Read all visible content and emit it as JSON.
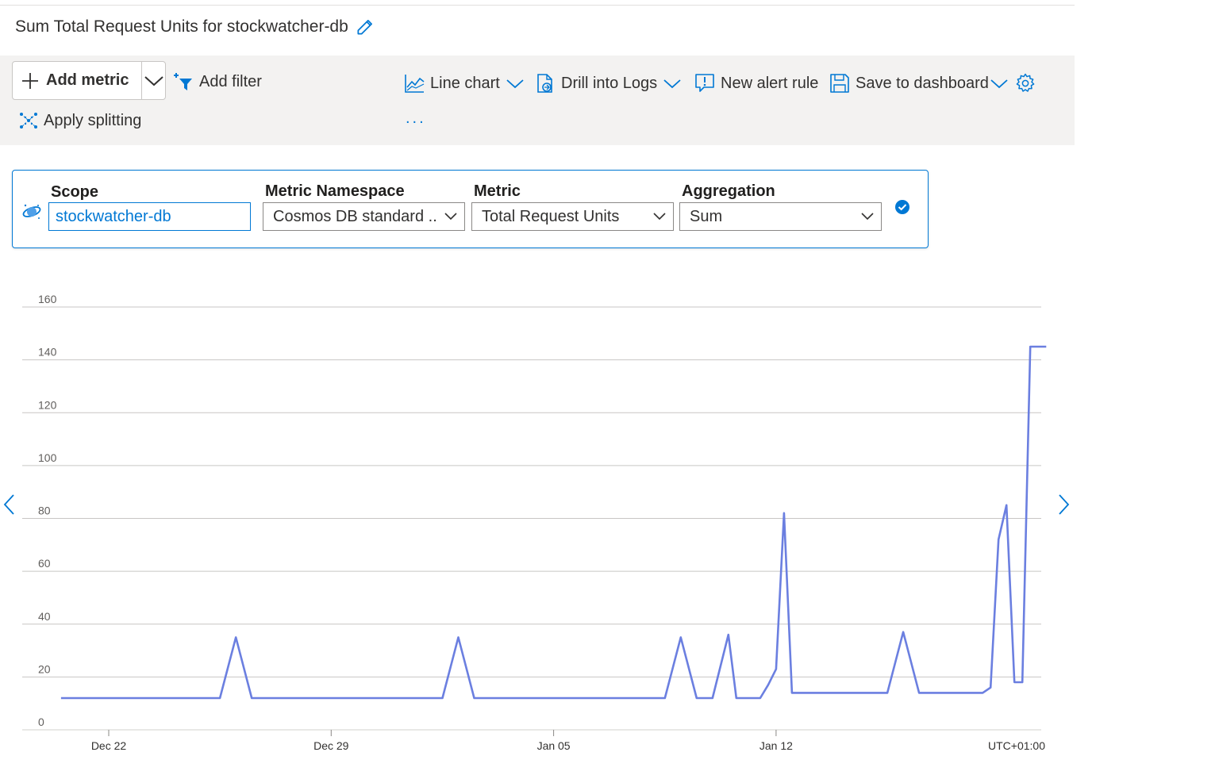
{
  "header": {
    "title": "Sum Total Request Units for stockwatcher-db"
  },
  "toolbar": {
    "add_metric": "Add metric",
    "add_filter": "Add filter",
    "apply_splitting": "Apply splitting",
    "line_chart": "Line chart",
    "drill_logs": "Drill into Logs",
    "new_alert": "New alert rule",
    "save_dashboard": "Save to dashboard",
    "more": "..."
  },
  "metric_row": {
    "scope_label": "Scope",
    "scope_value": "stockwatcher-db",
    "namespace_label": "Metric Namespace",
    "namespace_value": "Cosmos DB standard ...",
    "metric_label": "Metric",
    "metric_value": "Total Request Units",
    "aggregation_label": "Aggregation",
    "aggregation_value": "Sum"
  },
  "colors": {
    "accent": "#0078d4",
    "series": "#6b7fe0",
    "grid": "#c8c6c4",
    "toolbar_bg": "#f3f2f1"
  },
  "icons": {
    "edit": "pencil-icon",
    "add": "plus-icon",
    "filter": "filter-icon",
    "split": "split-icon",
    "chart": "line-chart-icon",
    "logs": "logs-icon",
    "alert": "alert-icon",
    "save": "save-icon",
    "settings": "gear-icon",
    "cosmos": "cosmos-db-icon",
    "confirm": "check-circle-icon"
  },
  "chart_data": {
    "type": "line",
    "title": "",
    "xlabel": "",
    "ylabel": "",
    "ylim": [
      0,
      160
    ],
    "yticks": [
      "0",
      "20",
      "40",
      "60",
      "80",
      "100",
      "120",
      "140",
      "160"
    ],
    "xticks": [
      "Dec 22",
      "Dec 29",
      "Jan 05",
      "Jan 12"
    ],
    "timezone": "UTC+01:00",
    "grid": true,
    "x": [
      "Dec 20 12:00",
      "Dec 25 12:00",
      "Dec 26 00:00",
      "Dec 26 12:00",
      "Jan 01 12:00",
      "Jan 02 00:00",
      "Jan 02 12:00",
      "Jan 08 12:00",
      "Jan 09 00:00",
      "Jan 09 12:00",
      "Jan 10 00:00",
      "Jan 10 12:00",
      "Jan 10 18:00",
      "Jan 11 12:00",
      "Jan 11 18:00",
      "Jan 12 00:00",
      "Jan 12 06:00",
      "Jan 12 12:00",
      "Jan 15 12:00",
      "Jan 16 00:00",
      "Jan 16 12:00",
      "Jan 18 12:00",
      "Jan 18 18:00",
      "Jan 19 00:00",
      "Jan 19 06:00",
      "Jan 19 12:00",
      "Jan 19 18:00",
      "Jan 20 00:00",
      "Jan 20 06:00",
      "Jan 20 12:00"
    ],
    "series": [
      {
        "name": "",
        "values": [
          12,
          12,
          35,
          12,
          12,
          35,
          12,
          12,
          35,
          12,
          12,
          36,
          12,
          12,
          17,
          23,
          82,
          14,
          14,
          37,
          14,
          14,
          16,
          72,
          85,
          18,
          18,
          145,
          145,
          145
        ]
      }
    ]
  }
}
